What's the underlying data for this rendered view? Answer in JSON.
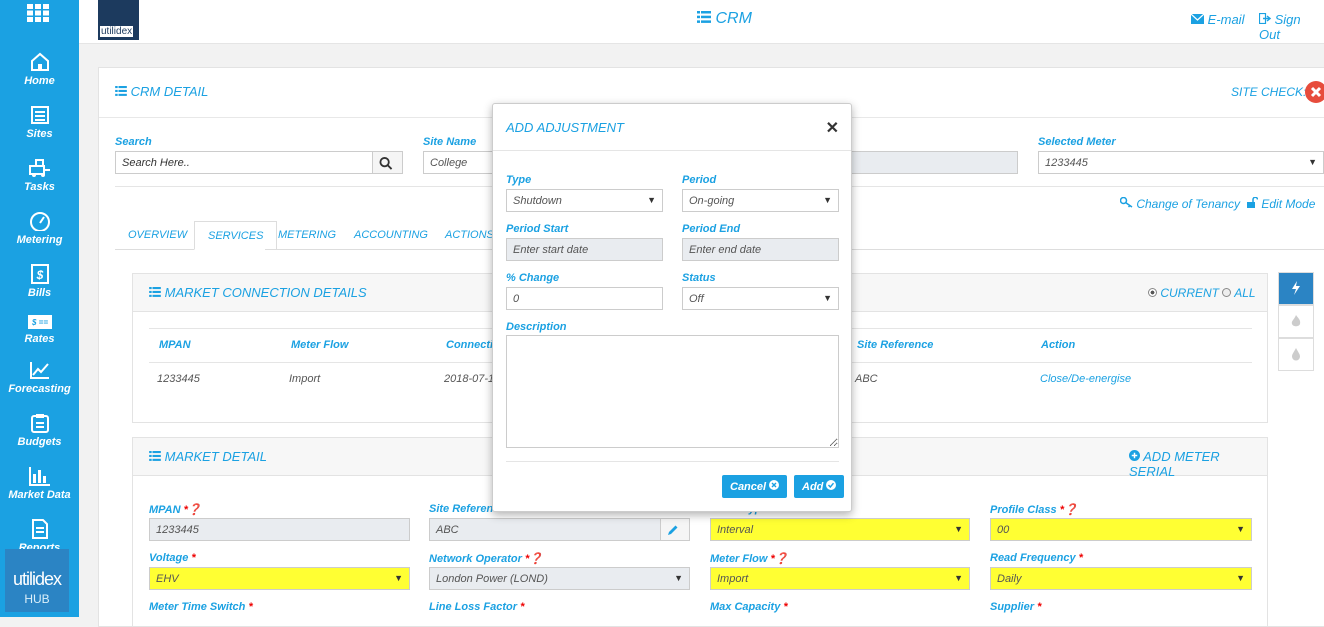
{
  "app": {
    "crm_title": "CRM",
    "email": "E-mail",
    "sign_out": "Sign Out",
    "logo_text": "utilidex"
  },
  "sidebar": {
    "items": [
      {
        "label": "Home",
        "icon": "home-icon"
      },
      {
        "label": "Sites",
        "icon": "sites-icon"
      },
      {
        "label": "Tasks",
        "icon": "tasks-icon"
      },
      {
        "label": "Metering",
        "icon": "gauge-icon"
      },
      {
        "label": "Bills",
        "icon": "bills-icon"
      },
      {
        "label": "Rates",
        "icon": "rates-icon"
      },
      {
        "label": "Forecasting",
        "icon": "chart-line-icon"
      },
      {
        "label": "Budgets",
        "icon": "clipboard-icon"
      },
      {
        "label": "Market Data",
        "icon": "bar-chart-icon"
      },
      {
        "label": "Reports",
        "icon": "document-icon"
      }
    ],
    "hub_line1": "utilidex",
    "hub_line2": "HUB"
  },
  "crm": {
    "title": "CRM DETAIL",
    "site_check": "SITE CHECK:",
    "search_label": "Search",
    "search_placeholder": "Search Here..",
    "site_name_label": "Site Name",
    "site_name_value": "College",
    "selected_meter_label": "Selected Meter",
    "selected_meter_value": "1233445",
    "change_of_tenancy": "Change of Tenancy",
    "edit_mode": "Edit Mode",
    "tabs": [
      "OVERVIEW",
      "SERVICES",
      "METERING",
      "ACCOUNTING",
      "ACTIONS &"
    ]
  },
  "market_connection": {
    "title": "MARKET CONNECTION DETAILS",
    "current": "CURRENT",
    "all": "ALL",
    "headers": [
      "MPAN",
      "Meter Flow",
      "Connection",
      "Site Reference",
      "Action"
    ],
    "row": {
      "mpan": "1233445",
      "flow": "Import",
      "connection": "2018-07-1",
      "site_ref": "ABC",
      "action": "Close/De-energise"
    }
  },
  "market_detail": {
    "title": "MARKET DETAIL",
    "add_serial": "ADD METER SERIAL",
    "mpan_label": "MPAN",
    "mpan_value": "1233445",
    "site_ref_label": "Site Reference",
    "site_ref_value": "ABC",
    "meter_type_label": "Meter Type",
    "meter_type_value": "Interval",
    "profile_class_label": "Profile Class",
    "profile_class_value": "00",
    "voltage_label": "Voltage",
    "voltage_value": "EHV",
    "network_op_label": "Network Operator",
    "network_op_value": "London Power (LOND)",
    "meter_flow_label": "Meter Flow",
    "meter_flow_value": "Import",
    "read_freq_label": "Read Frequency",
    "read_freq_value": "Daily",
    "mts_label": "Meter Time Switch",
    "llf_label": "Line Loss Factor",
    "max_cap_label": "Max Capacity",
    "supplier_label": "Supplier"
  },
  "modal": {
    "title": "ADD ADJUSTMENT",
    "type_label": "Type",
    "type_value": "Shutdown",
    "period_label": "Period",
    "period_value": "On-going",
    "start_label": "Period Start",
    "start_placeholder": "Enter start date",
    "end_label": "Period End",
    "end_placeholder": "Enter end date",
    "change_label": "% Change",
    "change_value": "0",
    "status_label": "Status",
    "status_value": "Off",
    "description_label": "Description",
    "cancel": "Cancel",
    "add": "Add"
  },
  "colors": {
    "accent": "#1ba1e2",
    "highlight": "#ffff33",
    "danger": "#e74c3c"
  }
}
